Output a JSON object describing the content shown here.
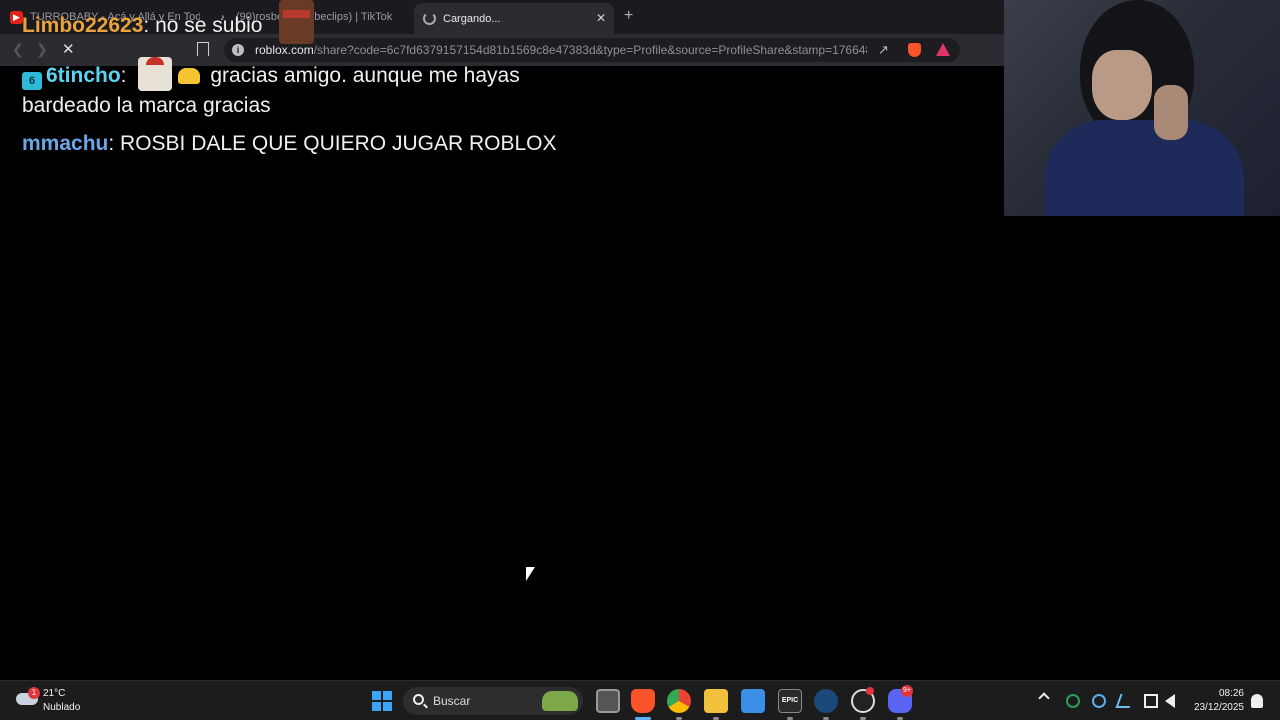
{
  "browser": {
    "tabs": [
      {
        "label": "TURROBABY - Acá y Allá y En Todos l",
        "favicon": "youtube-icon"
      },
      {
        "label": "(90)rosbe... (rosbeclips) | TikTok",
        "favicon": "tiktok-icon"
      },
      {
        "label": "Cargando...",
        "favicon": "loading-spinner-icon"
      }
    ],
    "new_tab_glyph": "+",
    "close_glyph": "✕",
    "url_host": "roblox.com",
    "url_path": "/share?code=6c7fd6379157154d81b1569c8e47383d&type=Profile&source=ProfileShare&stamp=176648..."
  },
  "chat": {
    "messages": [
      {
        "user": "Limbo22623",
        "sep": ":",
        "text": "no se subio"
      },
      {
        "badge": "6",
        "user": "6tincho",
        "sep": ":",
        "text": "gracias amigo. aunque me hayas",
        "text_cont": "bardeado la marca gracias"
      },
      {
        "user": "mmachu",
        "sep": ":",
        "text": "ROSBI DALE QUE QUIERO JUGAR ROBLOX"
      }
    ]
  },
  "taskbar": {
    "weather": {
      "temp": "21°C",
      "desc": "Nublado",
      "badge": "1"
    },
    "search_label": "Buscar",
    "epic_label": "EPIC",
    "discord_badge": "9+",
    "clock_time": "08:26",
    "clock_date": "23/12/2025"
  },
  "colors": {
    "accent": "#60b0f5",
    "brave": "#fb542b",
    "username_orange": "#e9a33b",
    "username_cyan": "#5ad2f0",
    "username_blue": "#6aa6e8"
  }
}
